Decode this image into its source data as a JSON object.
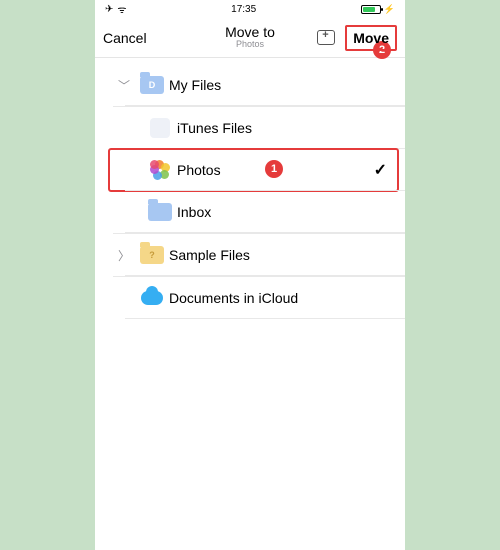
{
  "status": {
    "time": "17:35",
    "airplane": "✈",
    "wifi": "ᯤ",
    "charge": "⚡"
  },
  "nav": {
    "cancel": "Cancel",
    "title": "Move to",
    "subtitle": "Photos",
    "move": "Move"
  },
  "callouts": {
    "one": "1",
    "two": "2"
  },
  "folders": {
    "myfiles": "My Files",
    "itunes": "iTunes Files",
    "photos": "Photos",
    "inbox": "Inbox",
    "sample": "Sample Files",
    "icloud": "Documents in iCloud",
    "myfiles_letter": "D",
    "sample_letter": "?"
  },
  "disclosure": {
    "down": "﹀",
    "right": "〉"
  },
  "check": "✓"
}
